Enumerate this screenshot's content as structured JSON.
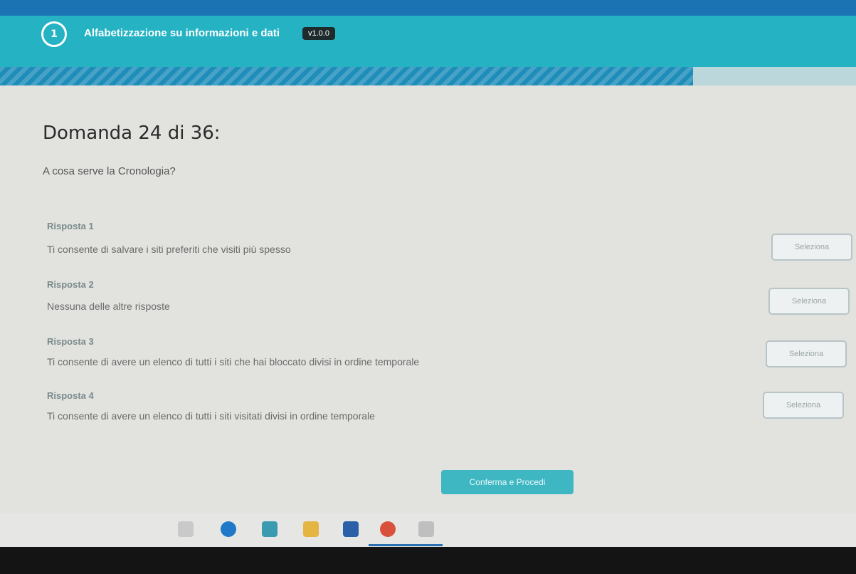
{
  "header": {
    "step_number": "1",
    "title": "Alfabetizzazione su informazioni e dati",
    "version": "v1.0.0"
  },
  "progress": {
    "current": 24,
    "total": 36,
    "fraction": 0.81
  },
  "question": {
    "title": "Domanda 24 di 36:",
    "text": "A cosa serve la Cronologia?"
  },
  "answers": [
    {
      "label": "Risposta 1",
      "text": "Ti consente di salvare i siti preferiti che visiti più spesso",
      "button": "Seleziona"
    },
    {
      "label": "Risposta 2",
      "text": "Nessuna delle altre risposte",
      "button": "Seleziona"
    },
    {
      "label": "Risposta 3",
      "text": "Ti consente di avere un elenco di tutti i siti che hai bloccato divisi in ordine temporale",
      "button": "Seleziona"
    },
    {
      "label": "Risposta 4",
      "text": "Ti consente di avere un elenco di tutti i siti visitati divisi in ordine temporale",
      "button": "Seleziona"
    }
  ],
  "confirm_button": "Conferma e Procedi",
  "colors": {
    "header": "#25b3c4",
    "top_strip": "#1b73b3",
    "progress_fill": "#1e8db9",
    "confirm_button": "#3fb7c3"
  },
  "taskbar": {
    "icons": [
      "search-icon",
      "edge-icon",
      "app-icon",
      "files-icon",
      "word-icon",
      "chrome-icon",
      "app-icon"
    ]
  }
}
